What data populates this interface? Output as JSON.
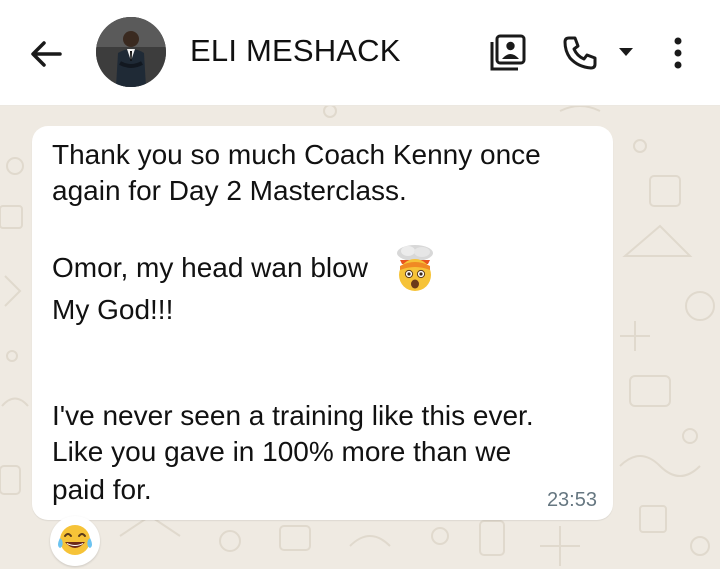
{
  "header": {
    "contact_name": "ELI MESHACK",
    "icons": [
      "back-arrow-icon",
      "contact-card-icon",
      "phone-icon",
      "dropdown-icon",
      "more-vert-icon"
    ]
  },
  "message": {
    "lines": [
      "Thank you so much Coach Kenny once",
      "again for Day 2 Masterclass.",
      "Omor, my head wan blow",
      "My God!!!",
      "I've never seen a training like this ever.",
      "Like you gave in 100% more than we",
      "paid for."
    ],
    "inline_emoji": "exploding-head-emoji",
    "time": "23:53",
    "reaction": "face-with-tears-of-joy-emoji"
  },
  "colors": {
    "chat_background": "#efeae2",
    "bubble": "#ffffff",
    "timestamp": "#667781"
  }
}
